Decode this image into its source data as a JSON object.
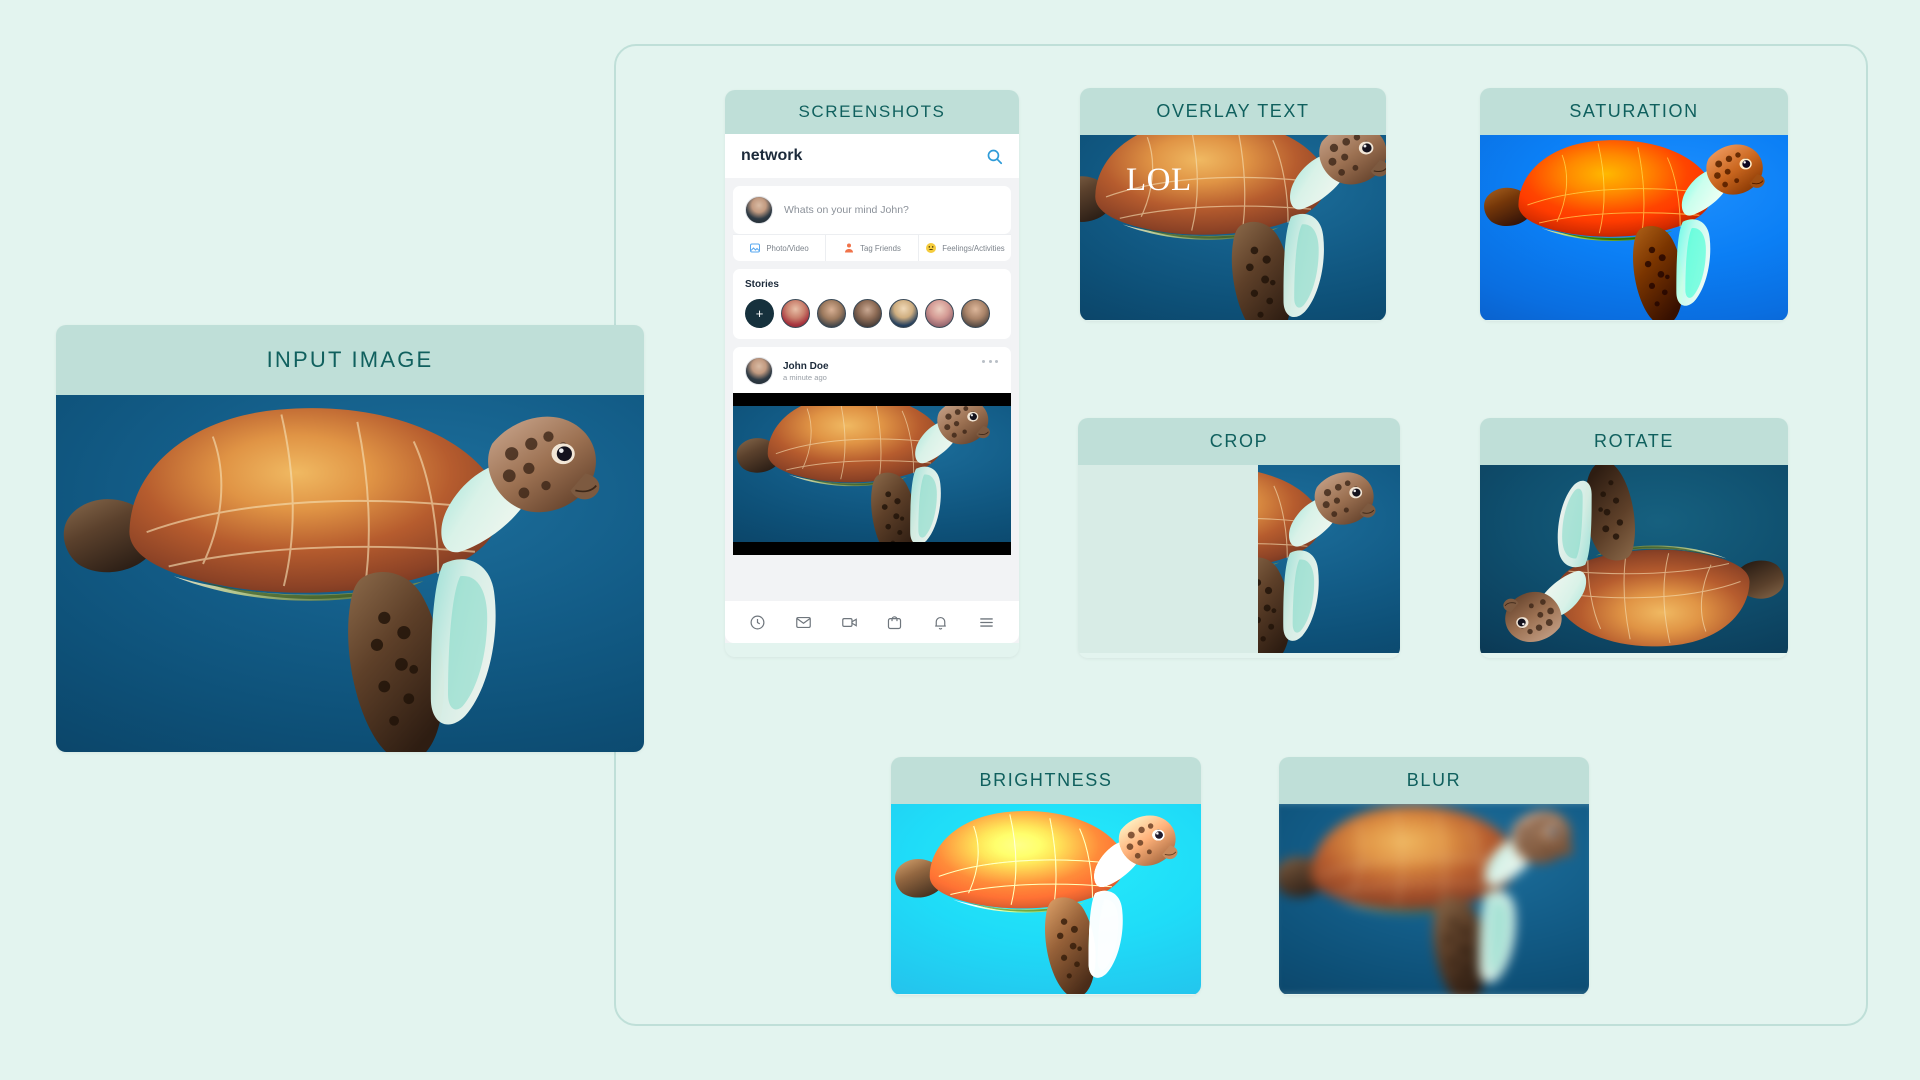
{
  "theme": {
    "page_background": "#e3f4ef",
    "card_header_background": "#bfdfd8",
    "card_header_text": "#10605e",
    "container_border": "#bfdfd8",
    "accent_blue": "#1e90ff"
  },
  "input_card": {
    "title": "INPUT IMAGE",
    "image_alt": "sea-turtle-underwater"
  },
  "screenshots_card": {
    "title": "SCREENSHOTS",
    "phone": {
      "search": {
        "brand": "network",
        "icon": "search-icon"
      },
      "compose": {
        "placeholder": "Whats on your mind John?",
        "actions": [
          {
            "label": "Photo/Video",
            "icon": "photo-icon",
            "color": "#5aa9f0"
          },
          {
            "label": "Tag Friends",
            "icon": "tag-friends-icon",
            "color": "#f0734a"
          },
          {
            "label": "Feelings/Activities",
            "icon": "emoji-icon",
            "color": "#f5cc3d"
          }
        ]
      },
      "stories": {
        "title": "Stories",
        "add_label": "+",
        "count": 6
      },
      "post": {
        "author": "John Doe",
        "timestamp": "a minute ago",
        "menu": "more-options"
      },
      "nav": [
        {
          "icon": "clock-icon",
          "name": "recent"
        },
        {
          "icon": "envelope-icon",
          "name": "messages"
        },
        {
          "icon": "video-camera-icon",
          "name": "video"
        },
        {
          "icon": "shopping-bag-icon",
          "name": "marketplace"
        },
        {
          "icon": "bell-icon",
          "name": "notifications"
        },
        {
          "icon": "hamburger-menu-icon",
          "name": "menu"
        }
      ]
    }
  },
  "overlay_card": {
    "title": "OVERLAY TEXT",
    "overlay_text": "LOL"
  },
  "saturation_card": {
    "title": "SATURATION"
  },
  "crop_card": {
    "title": "CROP"
  },
  "rotate_card": {
    "title": "ROTATE"
  },
  "brightness_card": {
    "title": "BRIGHTNESS"
  },
  "blur_card": {
    "title": "BLUR"
  }
}
